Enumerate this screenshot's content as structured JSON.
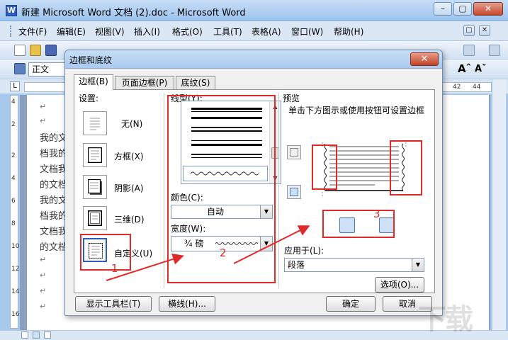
{
  "window": {
    "title": "新建 Microsoft Word 文档 (2).doc - Microsoft Word",
    "minimize": "–",
    "maximize": "▢",
    "close": "✕"
  },
  "menubar": {
    "items": [
      "文件(F)",
      "编辑(E)",
      "视图(V)",
      "插入(I)",
      "格式(O)",
      "工具(T)",
      "表格(A)",
      "窗口(W)",
      "帮助(H)"
    ]
  },
  "toolbar": {
    "style_box": "正文",
    "font_grow": "Aˆ",
    "font_shrink": "Aˇ"
  },
  "ruler": {
    "left_mark": "L",
    "right_nums": [
      "42",
      "44"
    ]
  },
  "left_ruler": {
    "nums": [
      "4",
      "2",
      "2",
      "4",
      "6",
      "8",
      "10",
      "12",
      "14",
      "16"
    ]
  },
  "document": {
    "lines": [
      "我的文",
      "档我的",
      "文档我",
      "的文档",
      "我的文",
      "档我的",
      "文档我",
      "的文档"
    ],
    "para_mark": "↵"
  },
  "dialog": {
    "title": "边框和底纹",
    "close": "✕",
    "tabs": [
      "边框(B)",
      "页面边框(P)",
      "底纹(S)"
    ],
    "settings_label": "设置:",
    "settings": [
      "无(N)",
      "方框(X)",
      "阴影(A)",
      "三维(D)",
      "自定义(U)"
    ],
    "line_style_label": "线型(Y):",
    "color_label": "颜色(C):",
    "color_value": "自动",
    "width_label": "宽度(W):",
    "width_value": "¾ 磅",
    "preview_label": "预览",
    "preview_hint": "单击下方图示或使用按钮可设置边框",
    "apply_label": "应用于(L):",
    "apply_value": "段落",
    "options_button": "选项(O)...",
    "show_toolbar_button": "显示工具栏(T)",
    "hline_button": "横线(H)...",
    "ok_button": "确定",
    "cancel_button": "取消"
  },
  "annotations": {
    "n1": "1",
    "n2": "2",
    "n3": "3"
  },
  "colors": {
    "annotation": "#e02a2a",
    "titlebar": "#b5d3f3"
  }
}
